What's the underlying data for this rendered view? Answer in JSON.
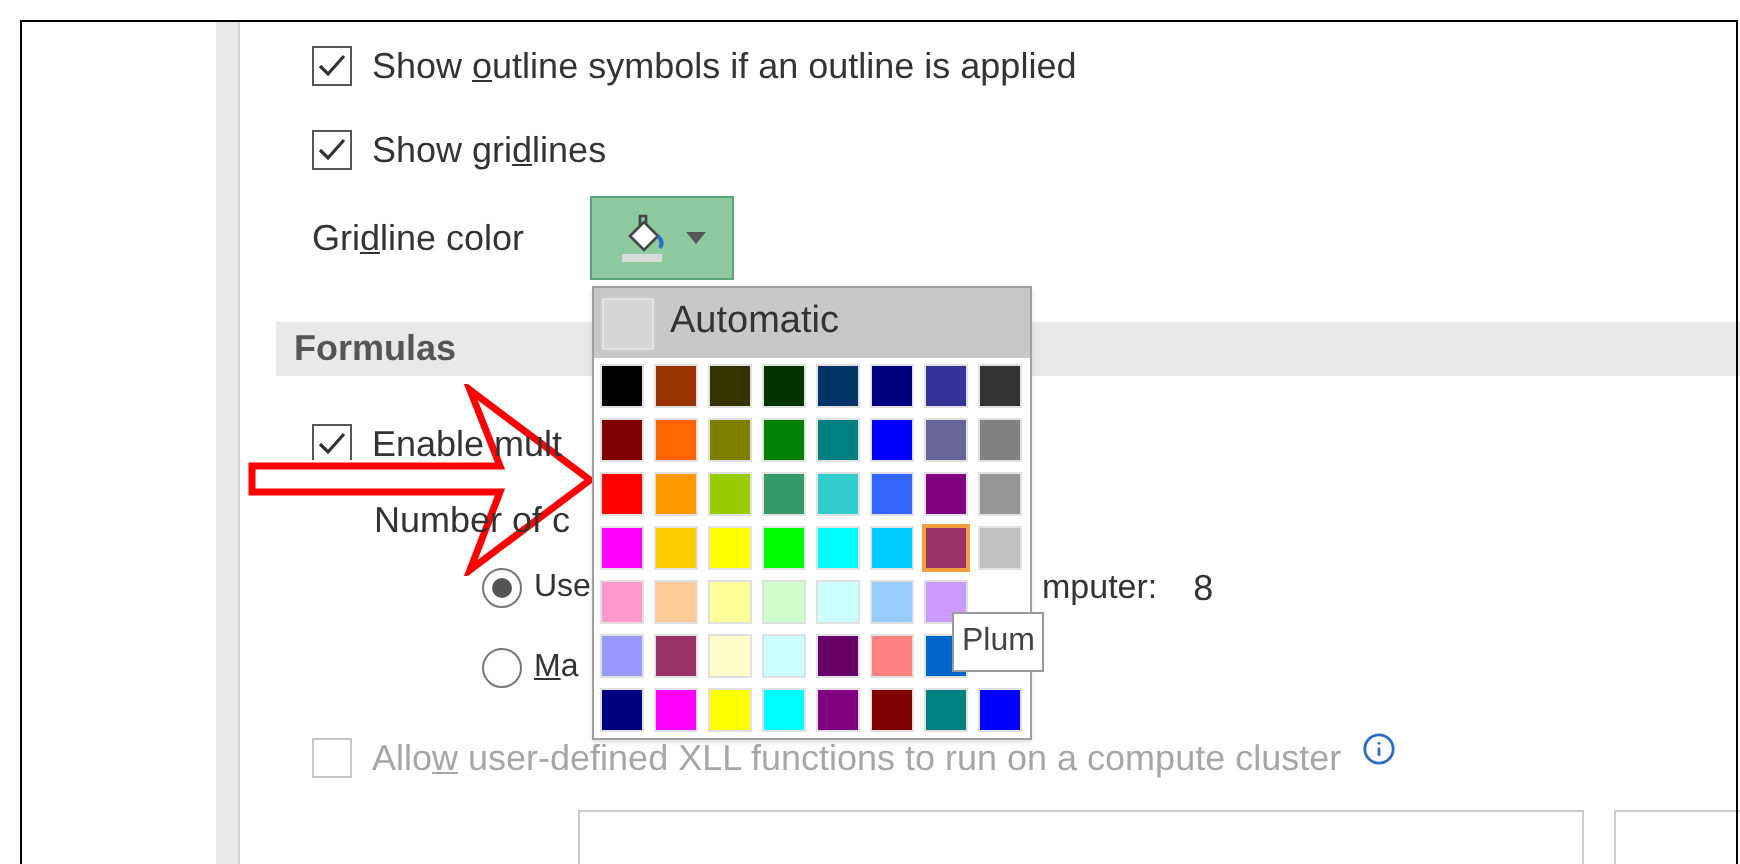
{
  "options": [
    {
      "kind": "checkbox",
      "label": [
        "Show ",
        "o",
        "utline symbols if an outline is applied"
      ],
      "checked": true
    },
    {
      "kind": "checkbox",
      "label": [
        "Show gri",
        "d",
        "lines"
      ],
      "checked": true
    }
  ],
  "gridline_color": {
    "label": [
      "Gri",
      "d",
      "line color"
    ]
  },
  "color_menu": {
    "automatic": "Automatic",
    "tooltip": "Plum",
    "rows": [
      [
        {
          "color": "#000000",
          "selected": false
        },
        {
          "color": "#993300",
          "selected": false
        },
        {
          "color": "#333300",
          "selected": false
        },
        {
          "color": "#003300",
          "selected": false
        },
        {
          "color": "#003366",
          "selected": false
        },
        {
          "color": "#000080",
          "selected": false
        },
        {
          "color": "#333399",
          "selected": false
        },
        {
          "color": "#333333",
          "selected": false
        }
      ],
      [
        {
          "color": "#800000",
          "selected": false
        },
        {
          "color": "#ff6600",
          "selected": false
        },
        {
          "color": "#808000",
          "selected": false
        },
        {
          "color": "#008000",
          "selected": false
        },
        {
          "color": "#008080",
          "selected": false
        },
        {
          "color": "#0000ff",
          "selected": false
        },
        {
          "color": "#666699",
          "selected": false
        },
        {
          "color": "#808080",
          "selected": false
        }
      ],
      [
        {
          "color": "#ff0000",
          "selected": false
        },
        {
          "color": "#ff9900",
          "selected": false
        },
        {
          "color": "#99cc00",
          "selected": false
        },
        {
          "color": "#339966",
          "selected": false
        },
        {
          "color": "#33cccc",
          "selected": false
        },
        {
          "color": "#3366ff",
          "selected": false
        },
        {
          "color": "#800080",
          "selected": false
        },
        {
          "color": "#969696",
          "selected": false
        }
      ],
      [
        {
          "color": "#ff00ff",
          "selected": false
        },
        {
          "color": "#ffcc00",
          "selected": false
        },
        {
          "color": "#ffff00",
          "selected": false
        },
        {
          "color": "#00ff00",
          "selected": false
        },
        {
          "color": "#00ffff",
          "selected": false
        },
        {
          "color": "#00ccff",
          "selected": false
        },
        {
          "color": "#993366",
          "selected": true
        },
        {
          "color": "#c0c0c0",
          "selected": false
        }
      ],
      [
        {
          "color": "#ff99cc",
          "selected": false
        },
        {
          "color": "#ffcc99",
          "selected": false
        },
        {
          "color": "#ffff99",
          "selected": false
        },
        {
          "color": "#ccffcc",
          "selected": false
        },
        {
          "color": "#ccffff",
          "selected": false
        },
        {
          "color": "#99ccff",
          "selected": false
        },
        {
          "color": "#cc99ff",
          "selected": false
        }
      ],
      [
        {
          "color": "#9999ff",
          "selected": false
        },
        {
          "color": "#993366",
          "selected": false
        },
        {
          "color": "#ffffcc",
          "selected": false
        },
        {
          "color": "#ccffff",
          "selected": false
        },
        {
          "color": "#660066",
          "selected": false
        },
        {
          "color": "#ff8080",
          "selected": false
        },
        {
          "color": "#0066cc",
          "selected": false
        }
      ],
      [
        {
          "color": "#000080",
          "selected": false
        },
        {
          "color": "#ff00ff",
          "selected": false
        },
        {
          "color": "#ffff00",
          "selected": false
        },
        {
          "color": "#00ffff",
          "selected": false
        },
        {
          "color": "#800080",
          "selected": false
        },
        {
          "color": "#800000",
          "selected": false
        },
        {
          "color": "#008080",
          "selected": false
        },
        {
          "color": "#0000ff",
          "selected": false
        }
      ]
    ]
  },
  "formulas": {
    "heading": "Formulas",
    "multithread": {
      "label": "Enable mult",
      "checked": true
    },
    "threads_label": "Number of c",
    "thread_options": [
      {
        "label": "Use",
        "selected": true,
        "suffix": "mputer:",
        "value": "8"
      },
      {
        "label": [
          "M",
          "a"
        ],
        "selected": false
      }
    ],
    "xll": {
      "label": [
        "Allo",
        "w",
        " user-defined XLL functions to run on a compute cluster"
      ],
      "checked": false,
      "disabled": true
    }
  }
}
